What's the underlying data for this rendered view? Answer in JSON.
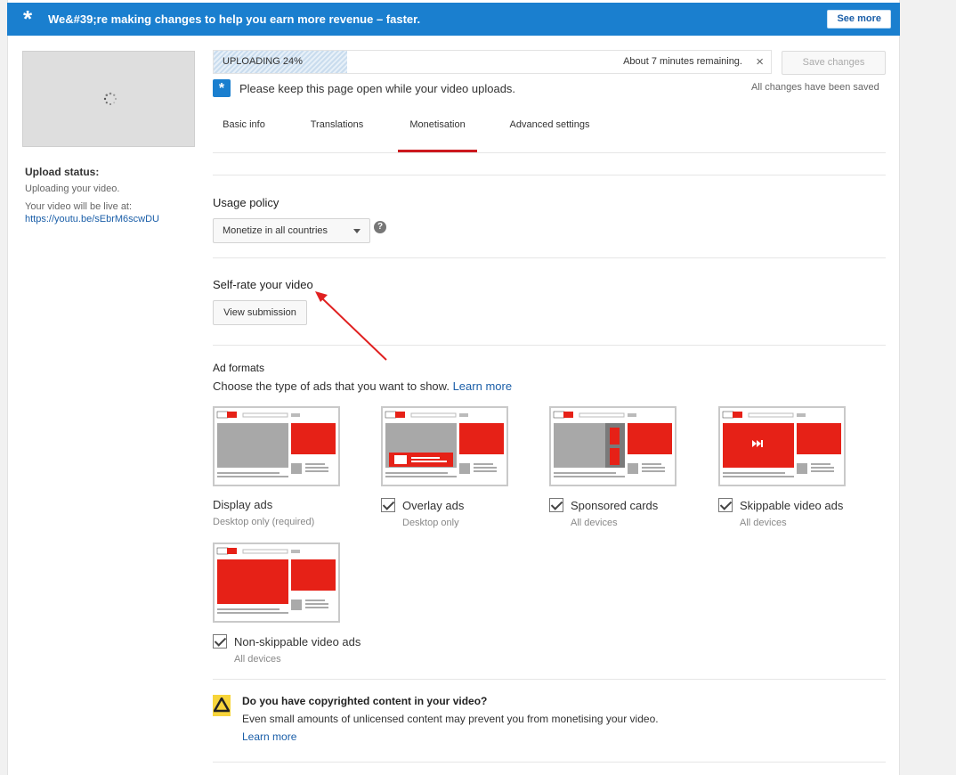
{
  "banner": {
    "icon": "asterisk-icon",
    "message": "We&#39;re making changes to help you earn more revenue – faster.",
    "see_more": "See more",
    "color": "#1a7fcf"
  },
  "sidebar": {
    "upload_status_title": "Upload status:",
    "upload_status_text": "Uploading your video.",
    "live_text": "Your video will be live at:",
    "live_link": "https://youtu.be/sEbrM6scwDU"
  },
  "upload": {
    "progress_label": "UPLOADING 24%",
    "progress_percent": 24,
    "remaining": "About 7 minutes remaining.",
    "close": "×",
    "save_changes": "Save changes",
    "saved_text": "All changes have been saved",
    "keep_open": "Please keep this page open while your video uploads."
  },
  "tabs": [
    {
      "label": "Basic info",
      "active": false
    },
    {
      "label": "Translations",
      "active": false
    },
    {
      "label": "Monetisation",
      "active": true
    },
    {
      "label": "Advanced settings",
      "active": false
    }
  ],
  "usage_policy": {
    "title": "Usage policy",
    "selected": "Monetize in all countries",
    "help": "?"
  },
  "self_rate": {
    "title": "Self-rate your video",
    "button": "View submission"
  },
  "ad_formats": {
    "title": "Ad formats",
    "description": "Choose the type of ads that you want to show.",
    "learn_more": "Learn more",
    "items": [
      {
        "label": "Display ads",
        "sub": "Desktop only (required)",
        "checked": null
      },
      {
        "label": "Overlay ads",
        "sub": "Desktop only",
        "checked": true
      },
      {
        "label": "Sponsored cards",
        "sub": "All devices",
        "checked": true
      },
      {
        "label": "Skippable video ads",
        "sub": "All devices",
        "checked": true
      },
      {
        "label": "Non-skippable video ads",
        "sub": "All devices",
        "checked": true
      }
    ]
  },
  "copyright": {
    "question": "Do you have copyrighted content in your video?",
    "description": "Even small amounts of unlicensed content may prevent you from monetising your video.",
    "learn_more": "Learn more"
  },
  "colors": {
    "accent_red": "#cc181e",
    "ad_red": "#e62117",
    "link": "#1a5ea8"
  }
}
